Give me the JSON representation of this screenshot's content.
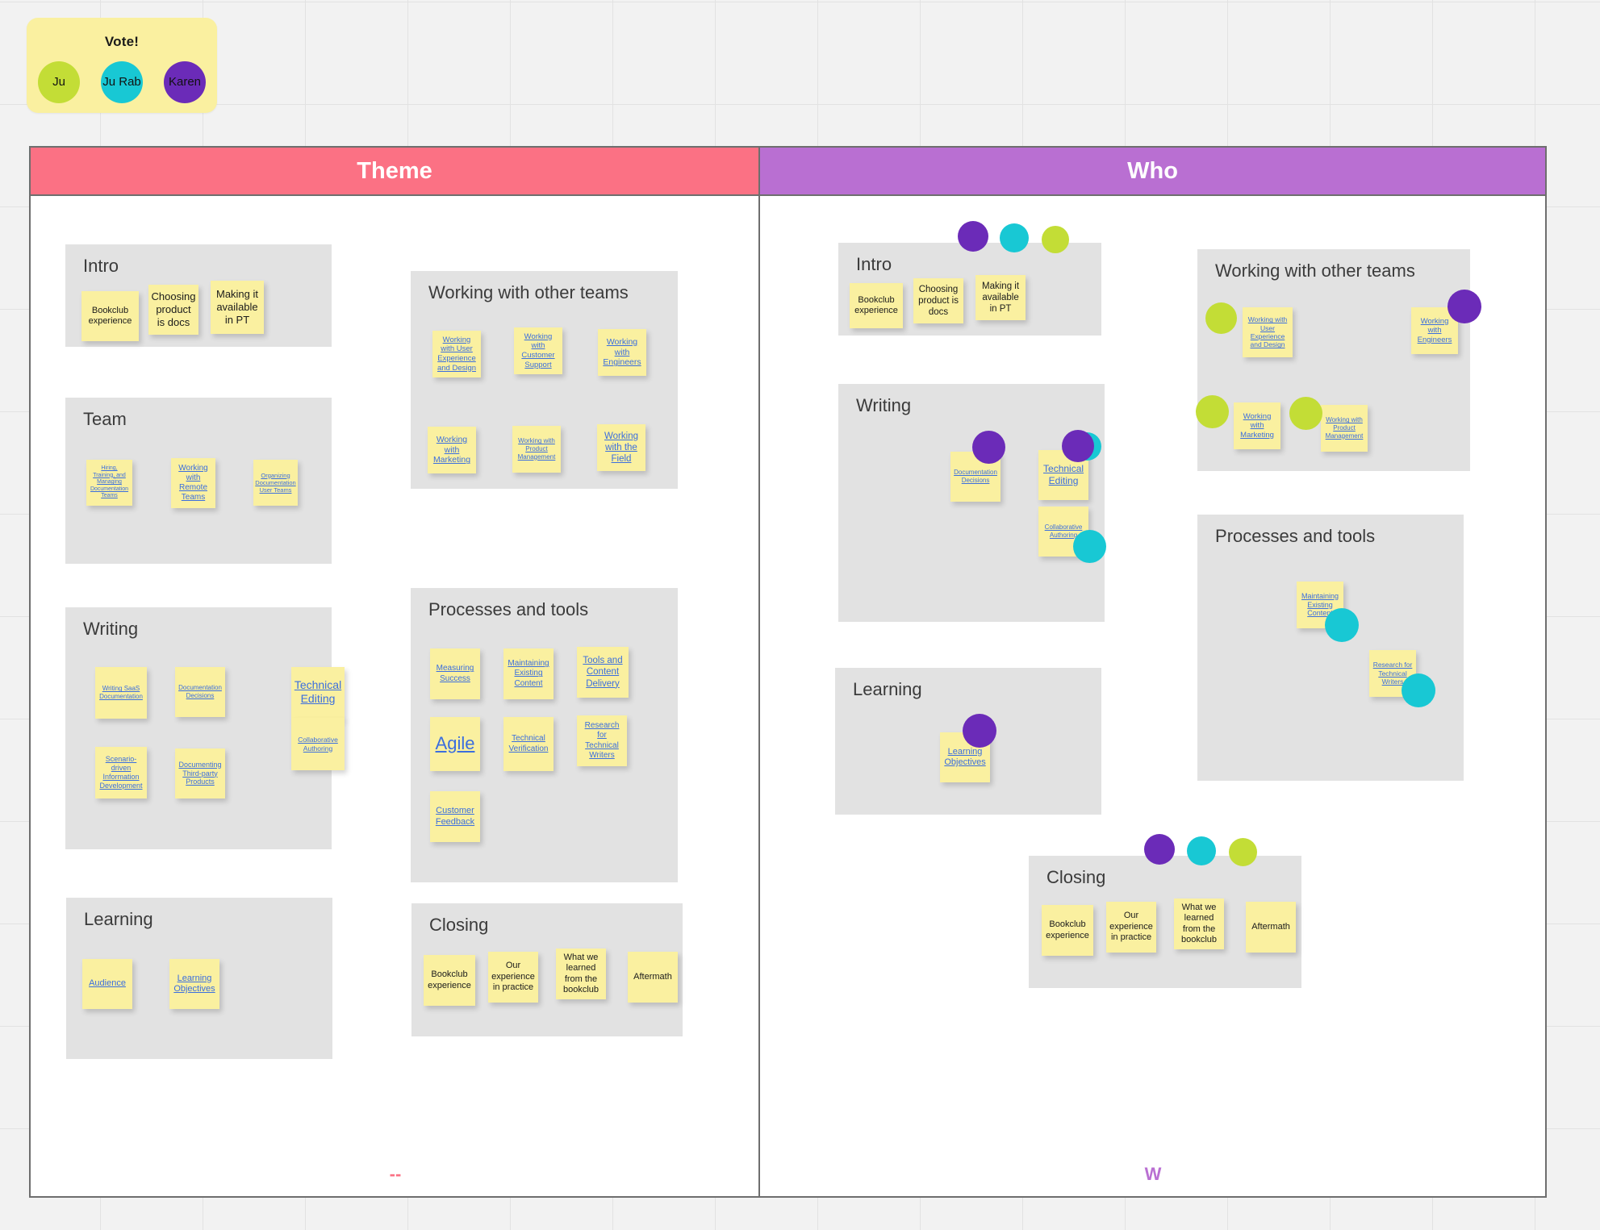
{
  "colors": {
    "purple": "#6B2BB8",
    "cyan": "#18C8D4",
    "green": "#C3DD36",
    "theme_header": "#FB7184",
    "who_header": "#B96FD2",
    "note_yellow": "#FAF0A0",
    "group_grey": "#E2E2E2",
    "link_blue": "#3B6EDE"
  },
  "vote_card": {
    "title": "Vote!",
    "avatars": [
      {
        "name": "Ju",
        "color": "#C3DD36"
      },
      {
        "name": "Ju Rab",
        "color": "#18C8D4"
      },
      {
        "name": "Karen",
        "color": "#6B2BB8"
      }
    ]
  },
  "columns": [
    {
      "id": "theme",
      "header": "Theme",
      "footer_label": "--",
      "groups": [
        {
          "title": "Intro",
          "notes": [
            {
              "text": "Bookclub experience",
              "style": "plain"
            },
            {
              "text": "Choosing product is docs",
              "style": "plain"
            },
            {
              "text": "Making it available in PT",
              "style": "plain"
            }
          ]
        },
        {
          "title": "Team",
          "notes": [
            {
              "text": "Hiring, Training, and Managing Documentation Teams",
              "style": "link"
            },
            {
              "text": "Working with Remote Teams",
              "style": "link"
            },
            {
              "text": "Organizing Documentation User Teams",
              "style": "link"
            }
          ]
        },
        {
          "title": "Writing",
          "notes": [
            {
              "text": "Writing SaaS Documentation",
              "style": "link"
            },
            {
              "text": "Documentation Decisions",
              "style": "link"
            },
            {
              "text": "Technical Editing",
              "style": "link"
            },
            {
              "text": "Collaborative Authoring",
              "style": "link"
            },
            {
              "text": "Scenario-driven Information Development",
              "style": "link"
            },
            {
              "text": "Documenting Third-party Products",
              "style": "link"
            }
          ]
        },
        {
          "title": "Learning",
          "notes": [
            {
              "text": "Audience",
              "style": "link"
            },
            {
              "text": "Learning Objectives",
              "style": "link"
            }
          ]
        },
        {
          "title": "Working with other teams",
          "notes": [
            {
              "text": "Working with User Experience and Design",
              "style": "link"
            },
            {
              "text": "Working with Customer Support",
              "style": "link"
            },
            {
              "text": "Working with Engineers",
              "style": "link"
            },
            {
              "text": "Working with Marketing",
              "style": "link"
            },
            {
              "text": "Working with Product Management",
              "style": "link"
            },
            {
              "text": "Working with the Field",
              "style": "link"
            }
          ]
        },
        {
          "title": "Processes and tools",
          "notes": [
            {
              "text": "Measuring Success",
              "style": "link"
            },
            {
              "text": "Maintaining Existing Content",
              "style": "link"
            },
            {
              "text": "Tools and Content Delivery",
              "style": "link"
            },
            {
              "text": "Agile",
              "style": "link"
            },
            {
              "text": "Technical Verification",
              "style": "link"
            },
            {
              "text": "Research for Technical Writers",
              "style": "link"
            },
            {
              "text": "Customer Feedback",
              "style": "link"
            }
          ]
        },
        {
          "title": "Closing",
          "notes": [
            {
              "text": "Bookclub experience",
              "style": "plain"
            },
            {
              "text": "Our experience in practice",
              "style": "plain"
            },
            {
              "text": "What we learned from the bookclub",
              "style": "plain"
            },
            {
              "text": "Aftermath",
              "style": "plain"
            }
          ]
        }
      ]
    },
    {
      "id": "who",
      "header": "Who",
      "footer_label": "W",
      "groups": [
        {
          "title": "Intro",
          "votes_above": [
            "#6B2BB8",
            "#18C8D4",
            "#C3DD36"
          ],
          "notes": [
            {
              "text": "Bookclub experience",
              "style": "plain"
            },
            {
              "text": "Choosing product is docs",
              "style": "plain"
            },
            {
              "text": "Making it available in PT",
              "style": "plain"
            }
          ]
        },
        {
          "title": "Writing",
          "notes": [
            {
              "text": "Documentation Decisions",
              "style": "link",
              "votes": [
                "#6B2BB8"
              ]
            },
            {
              "text": "Technical Editing",
              "style": "link",
              "votes": [
                "#18C8D4",
                "#6B2BB8"
              ]
            },
            {
              "text": "Collaborative Authoring",
              "style": "link",
              "votes": [
                "#18C8D4"
              ]
            }
          ]
        },
        {
          "title": "Learning",
          "notes": [
            {
              "text": "Learning Objectives",
              "style": "link",
              "votes": [
                "#6B2BB8"
              ]
            }
          ]
        },
        {
          "title": "Working with other teams",
          "notes": [
            {
              "text": "Working with User Experience and Design",
              "style": "link",
              "votes": [
                "#C3DD36"
              ]
            },
            {
              "text": "Working with Engineers",
              "style": "link",
              "votes": [
                "#6B2BB8"
              ]
            },
            {
              "text": "Working with Marketing",
              "style": "link",
              "votes": [
                "#C3DD36"
              ]
            },
            {
              "text": "Working with Product Management",
              "style": "link",
              "votes": [
                "#C3DD36"
              ]
            }
          ]
        },
        {
          "title": "Processes and tools",
          "notes": [
            {
              "text": "Maintaining Existing Content",
              "style": "link",
              "votes": [
                "#18C8D4"
              ]
            },
            {
              "text": "Research for Technical Writers",
              "style": "link",
              "votes": [
                "#18C8D4"
              ]
            }
          ]
        },
        {
          "title": "Closing",
          "votes_above": [
            "#6B2BB8",
            "#18C8D4",
            "#C3DD36"
          ],
          "notes": [
            {
              "text": "Bookclub experience",
              "style": "plain"
            },
            {
              "text": "Our experience in practice",
              "style": "plain"
            },
            {
              "text": "What we learned from the bookclub",
              "style": "plain"
            },
            {
              "text": "Aftermath",
              "style": "plain"
            }
          ]
        }
      ]
    }
  ]
}
